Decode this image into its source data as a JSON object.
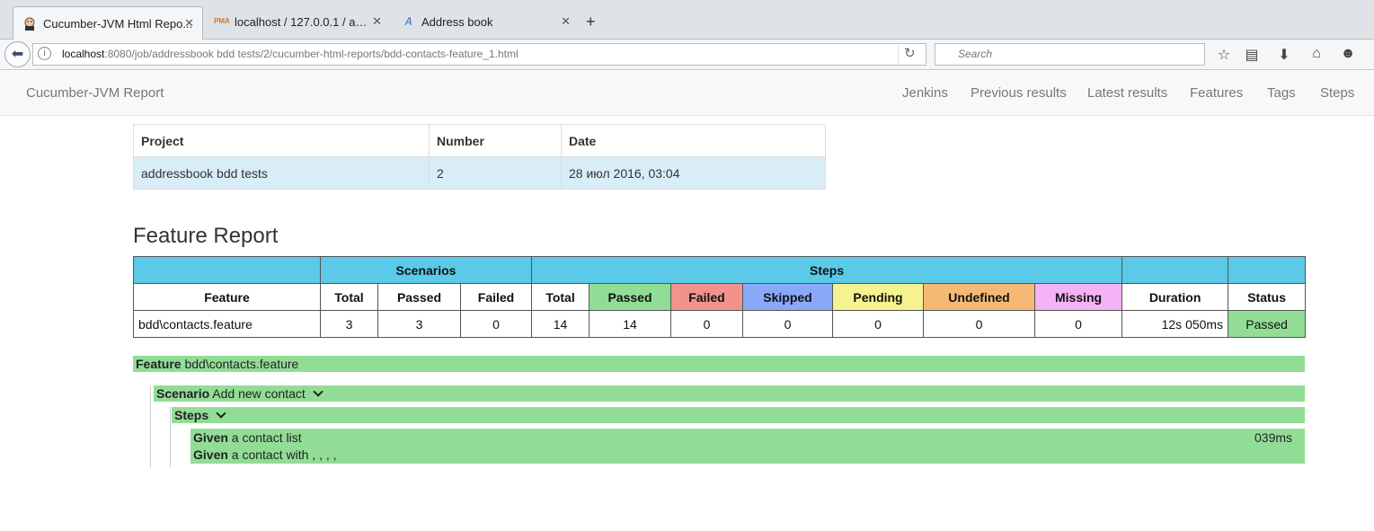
{
  "browser": {
    "tabs": [
      {
        "title": "Cucumber-JVM Html Repo...",
        "icon": "jenkins-icon",
        "active": true
      },
      {
        "title": "localhost / 127.0.0.1 / addr...",
        "icon": "phpmyadmin-icon",
        "active": false
      },
      {
        "title": "Address book",
        "icon": "document-icon",
        "active": false
      }
    ],
    "url_host": "localhost",
    "url_rest": ":8080/job/addressbook bdd tests/2/cucumber-html-reports/bdd-contacts-feature_1.html",
    "search_placeholder": "Search"
  },
  "nav": {
    "brand": "Cucumber-JVM Report",
    "links": [
      "Jenkins",
      "Previous results",
      "Latest results",
      "Features",
      "Tags",
      "Steps"
    ]
  },
  "build_info": {
    "headers": [
      "Project",
      "Number",
      "Date"
    ],
    "values": [
      "addressbook bdd tests",
      "2",
      "28 июл 2016, 03:04"
    ]
  },
  "report": {
    "title": "Feature Report",
    "group_headers": {
      "scenarios": "Scenarios",
      "steps": "Steps"
    },
    "columns": [
      "Feature",
      "Total",
      "Passed",
      "Failed",
      "Total",
      "Passed",
      "Failed",
      "Skipped",
      "Pending",
      "Undefined",
      "Missing",
      "Duration",
      "Status"
    ],
    "row": [
      "bdd\\contacts.feature",
      "3",
      "3",
      "0",
      "14",
      "14",
      "0",
      "0",
      "0",
      "0",
      "0",
      "12s 050ms",
      "Passed"
    ],
    "colors": {
      "passed": "#92dd96",
      "failed": "#f2928c",
      "skipped": "#8aa8f8",
      "pending": "#f5f28f",
      "undefined": "#f5b975",
      "missing": "#f5b2f5",
      "header": "#5bc9e8"
    }
  },
  "details": {
    "feature_kw": "Feature",
    "feature_name": "bdd\\contacts.feature",
    "scenario_kw": "Scenario",
    "scenario_name": "Add new contact",
    "steps_label": "Steps",
    "steps": [
      {
        "keyword": "Given",
        "text": "a contact list",
        "duration": "039ms"
      },
      {
        "keyword": "Given",
        "text": "a contact with , , , ,",
        "duration": ""
      }
    ]
  }
}
